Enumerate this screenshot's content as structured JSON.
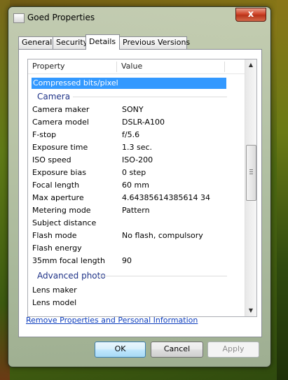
{
  "window": {
    "title": "Goed Properties",
    "close_glyph": "x"
  },
  "tabs": [
    {
      "label": "General"
    },
    {
      "label": "Security"
    },
    {
      "label": "Details",
      "active": true
    },
    {
      "label": "Previous Versions"
    }
  ],
  "list": {
    "columns": {
      "property": "Property",
      "value": "Value"
    },
    "selected_row": "Compressed bits/pixel",
    "groups": {
      "camera": "Camera",
      "advanced": "Advanced photo"
    },
    "camera_rows": [
      {
        "property": "Camera maker",
        "value": "SONY"
      },
      {
        "property": "Camera model",
        "value": "DSLR-A100"
      },
      {
        "property": "F-stop",
        "value": "f/5.6"
      },
      {
        "property": "Exposure time",
        "value": "1.3 sec."
      },
      {
        "property": "ISO speed",
        "value": "ISO-200"
      },
      {
        "property": "Exposure bias",
        "value": "0 step"
      },
      {
        "property": "Focal length",
        "value": "60 mm"
      },
      {
        "property": "Max aperture",
        "value": "4.64385614385614 34"
      },
      {
        "property": "Metering mode",
        "value": "Pattern"
      },
      {
        "property": "Subject distance",
        "value": ""
      },
      {
        "property": "Flash mode",
        "value": "No flash, compulsory"
      },
      {
        "property": "Flash energy",
        "value": ""
      },
      {
        "property": "35mm focal length",
        "value": "90"
      }
    ],
    "advanced_rows": [
      {
        "property": "Lens maker",
        "value": ""
      },
      {
        "property": "Lens model",
        "value": ""
      }
    ]
  },
  "link": {
    "remove_properties": "Remove Properties and Personal Information"
  },
  "buttons": {
    "ok": "OK",
    "cancel": "Cancel",
    "apply": "Apply"
  },
  "colors": {
    "selection": "#3399ff",
    "group_text": "#1e3287",
    "link": "#0b3cbd"
  }
}
